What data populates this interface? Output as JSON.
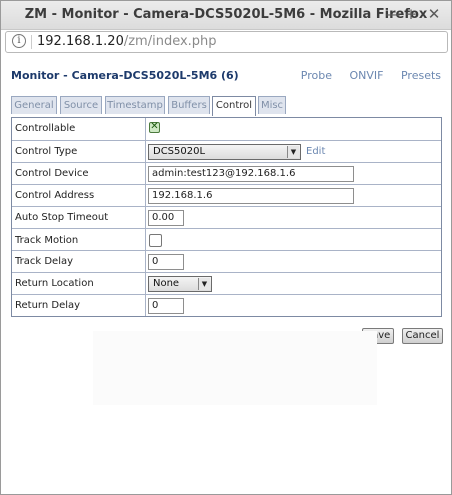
{
  "window": {
    "title": "ZM - Monitor - Camera-DCS5020L-5M6 - Mozilla Firefox",
    "minimize_glyph": "—",
    "maximize_glyph": "+",
    "close_glyph": "✕"
  },
  "urlbar": {
    "icon": "info-icon",
    "host": "192.168.1.20",
    "path": "/zm/index.php"
  },
  "page": {
    "title": "Monitor - Camera-DCS5020L-5M6 (6)",
    "links": [
      "Probe",
      "ONVIF",
      "Presets"
    ]
  },
  "tabs": [
    {
      "label": "General",
      "active": false
    },
    {
      "label": "Source",
      "active": false
    },
    {
      "label": "Timestamp",
      "active": false
    },
    {
      "label": "Buffers",
      "active": false
    },
    {
      "label": "Control",
      "active": true
    },
    {
      "label": "Misc",
      "active": false
    }
  ],
  "form": {
    "controllable": {
      "label": "Controllable",
      "checked": true,
      "mark": "✕"
    },
    "control_type": {
      "label": "Control Type",
      "value": "DCS5020L",
      "edit": "Edit"
    },
    "control_device": {
      "label": "Control Device",
      "value": "admin:test123@192.168.1.6"
    },
    "control_address": {
      "label": "Control Address",
      "value": "192.168.1.6"
    },
    "auto_stop_timeout": {
      "label": "Auto Stop Timeout",
      "value": "0.00"
    },
    "track_motion": {
      "label": "Track Motion",
      "checked": false
    },
    "track_delay": {
      "label": "Track Delay",
      "value": "0"
    },
    "return_location": {
      "label": "Return Location",
      "value": "None"
    },
    "return_delay": {
      "label": "Return Delay",
      "value": "0"
    }
  },
  "buttons": {
    "save": "Save",
    "cancel": "Cancel"
  },
  "select_arrow_glyph": "▼"
}
